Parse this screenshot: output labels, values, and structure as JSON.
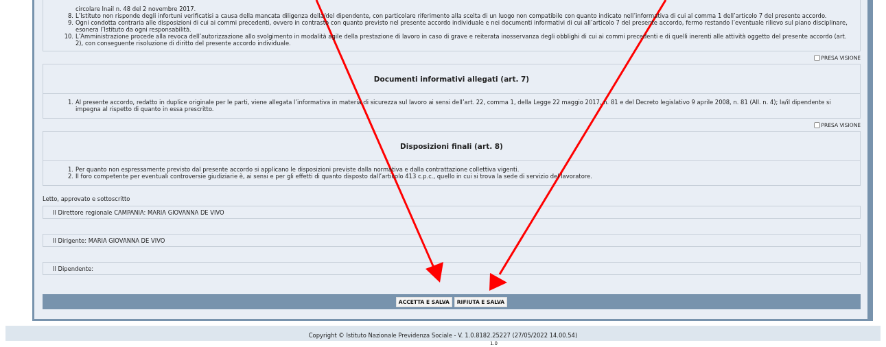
{
  "intro_section": {
    "items": [
      {
        "text": "circolare Inail n. 48 del 2 novembre 2017."
      },
      {
        "number": "8.",
        "text": "L’Istituto non risponde degli infortuni verificatisi a causa della mancata diligenza della/del dipendente, con particolare riferimento alla scelta di un luogo non compatibile con quanto indicato nell’informativa di cui al comma 1 dell’articolo 7 del presente accordo."
      },
      {
        "number": "9.",
        "text": "Ogni condotta contraria alle disposizioni di cui ai commi precedenti, ovvero in contrasto con quanto previsto nel presente accordo individuale e nei documenti informativi di cui all’articolo 7 del presente accordo, fermo restando l’eventuale rilievo sul piano disciplinare, esonera l’Istituto da ogni responsabilità."
      },
      {
        "number": "10.",
        "text": "L’Amministrazione procede alla revoca dell’autorizzazione allo svolgimento in modalità agile della prestazione di lavoro in caso di grave e reiterata inosservanza degli obblighi di cui ai commi precedenti e di quelli inerenti alle attività oggetto del presente accordo (art. 2), con conseguente risoluzione di diritto del presente accordo individuale."
      }
    ]
  },
  "sections": [
    {
      "acknowledgement": {
        "label": "PRESA VISIONE",
        "checked": false
      },
      "title": "Documenti informativi allegati (art. 7)",
      "items": [
        {
          "number": "1.",
          "text": "Al presente accordo, redatto in duplice originale per le parti, viene allegata l’informativa in materia di sicurezza sul lavoro ai sensi dell’art. 22, comma 1, della Legge 22 maggio 2017, n. 81 e del Decreto legislativo 9 aprile 2008, n. 81 (All. n. 4); la/il dipendente si impegna al rispetto di quanto in essa prescritto."
        }
      ]
    },
    {
      "acknowledgement": {
        "label": "PRESA VISIONE",
        "checked": false
      },
      "title": "Disposizioni finali (art. 8)",
      "items": [
        {
          "number": "1.",
          "text": "Per quanto non espressamente previsto dal presente accordo si applicano le disposizioni previste dalla normativa e dalla contrattazione collettiva vigenti."
        },
        {
          "number": "2.",
          "text": "Il foro competente per eventuali controversie giudiziarie è, ai sensi e per gli effetti di quanto disposto dall’articolo 413 c.p.c., quello in cui si trova la sede di servizio del lavoratore."
        }
      ]
    }
  ],
  "signature_caption": "Letto, approvato e sottoscritto",
  "signatures": [
    "Il Direttore regionale CAMPANIA: MARIA GIOVANNA DE VIVO",
    "Il Dirigente: MARIA GIOVANNA DE VIVO",
    "Il Dipendente:"
  ],
  "buttons": [
    "ACCETTA E SALVA",
    "RIFIUTA E SALVA"
  ],
  "footer": {
    "copyright": "Copyright © Istituto Nazionale Previdenza Sociale - V. 1.0.8182.25227 (27/05/2022 14.00.54)",
    "version": "1.0"
  }
}
